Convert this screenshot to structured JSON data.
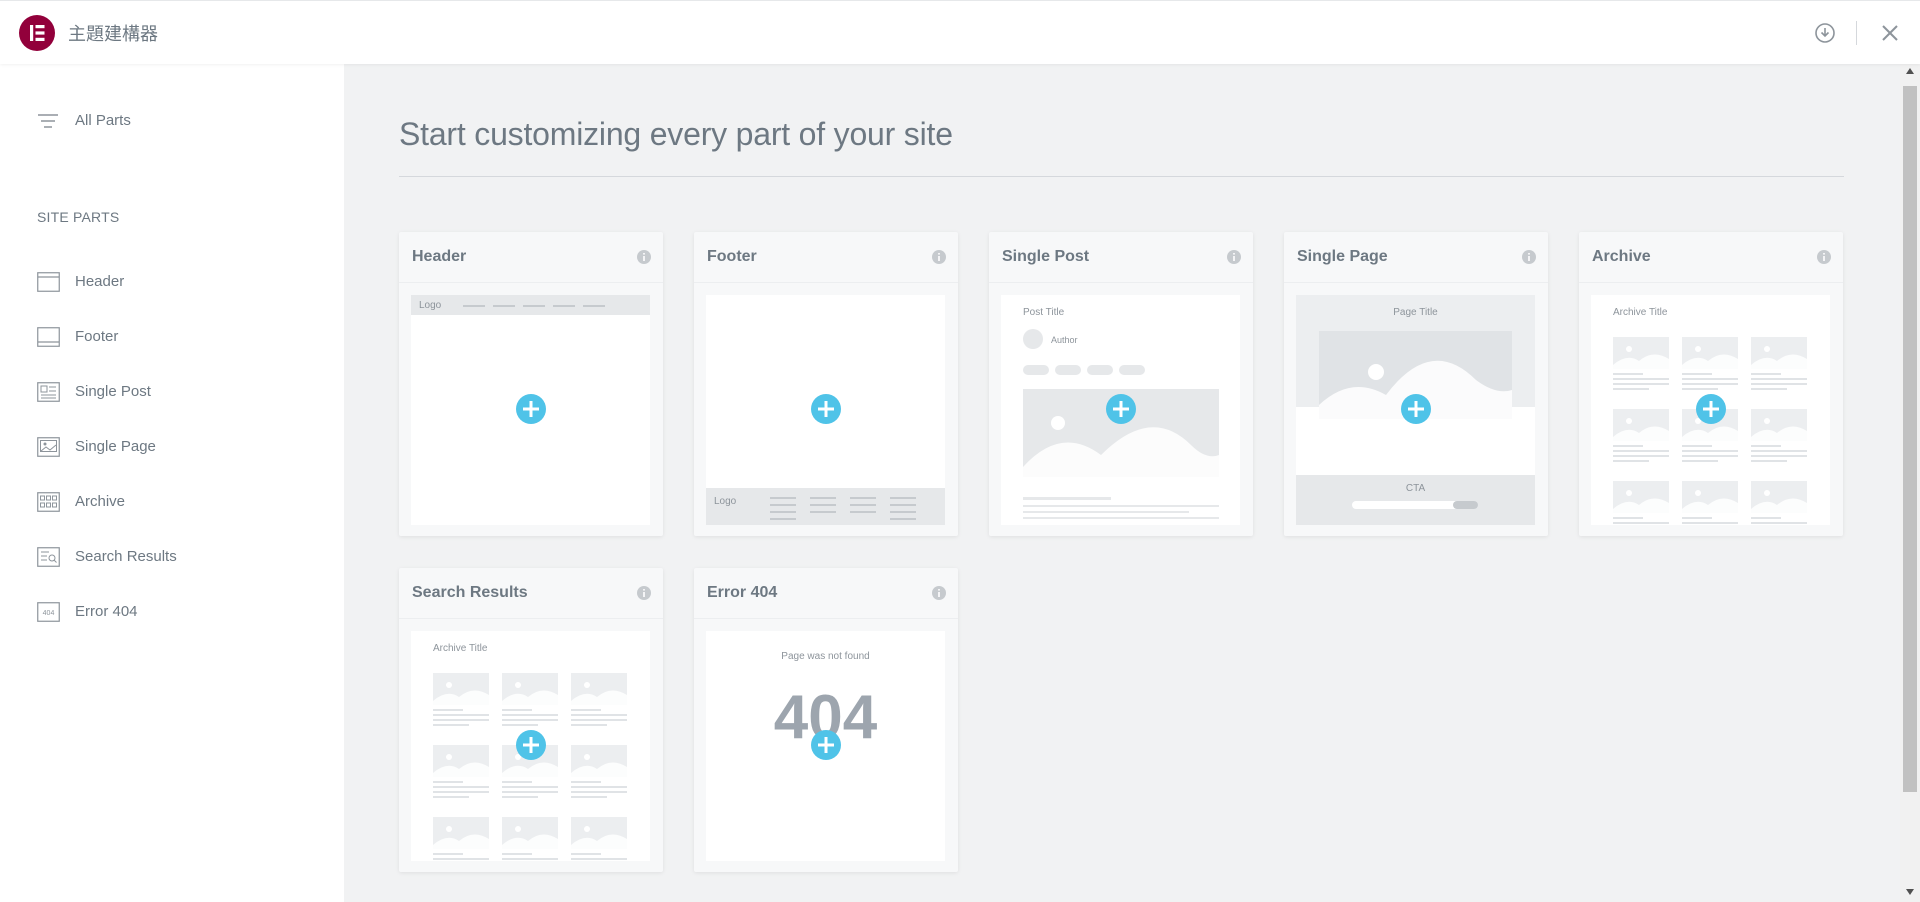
{
  "app": {
    "title": "主題建構器"
  },
  "sidebar": {
    "all_parts": "All Parts",
    "section_title": "SITE PARTS",
    "items": [
      {
        "label": "Header",
        "icon": "header-icon"
      },
      {
        "label": "Footer",
        "icon": "footer-icon"
      },
      {
        "label": "Single Post",
        "icon": "single-post-icon"
      },
      {
        "label": "Single Page",
        "icon": "single-page-icon"
      },
      {
        "label": "Archive",
        "icon": "archive-icon"
      },
      {
        "label": "Search Results",
        "icon": "search-results-icon"
      },
      {
        "label": "Error 404",
        "icon": "error-404-icon"
      }
    ]
  },
  "main": {
    "heading": "Start customizing every part of your site",
    "cards": [
      {
        "title": "Header",
        "preview": {
          "logo": "Logo"
        }
      },
      {
        "title": "Footer",
        "preview": {
          "logo": "Logo"
        }
      },
      {
        "title": "Single Post",
        "preview": {
          "post_title": "Post Title",
          "author": "Author"
        }
      },
      {
        "title": "Single Page",
        "preview": {
          "page_title": "Page Title",
          "cta": "CTA"
        }
      },
      {
        "title": "Archive",
        "preview": {
          "archive_title": "Archive Title"
        }
      },
      {
        "title": "Search Results",
        "preview": {
          "archive_title": "Archive Title"
        }
      },
      {
        "title": "Error 404",
        "preview": {
          "message": "Page was not found",
          "code": "404"
        }
      }
    ]
  },
  "colors": {
    "brand": "#92003b",
    "accent": "#4fc3e8",
    "text": "#6d7882",
    "placeholder": "#e6e8ea"
  }
}
